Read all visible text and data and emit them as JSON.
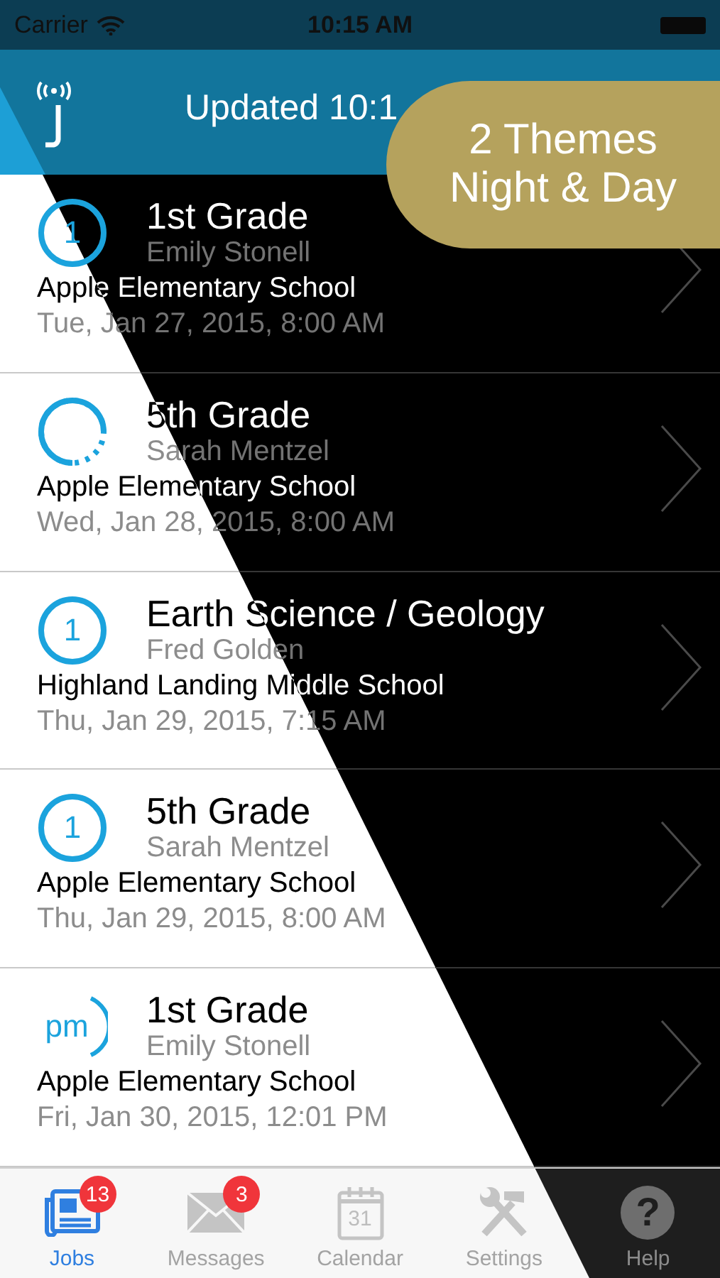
{
  "status_bar": {
    "carrier": "Carrier",
    "time": "10:15 AM"
  },
  "nav_bar": {
    "title": "Updated 10:1"
  },
  "promo_badge": {
    "lines": [
      "2 Themes",
      "Night & Day"
    ]
  },
  "jobs": [
    {
      "icon": {
        "kind": "number",
        "text": "1"
      },
      "title": "1st Grade",
      "teacher": "Emily Stonell",
      "school": "Apple Elementary School",
      "date": "Tue, Jan 27, 2015, 8:00 AM"
    },
    {
      "icon": {
        "kind": "partial"
      },
      "title": "5th Grade",
      "teacher": "Sarah Mentzel",
      "school": "Apple Elementary School",
      "date": "Wed, Jan 28, 2015, 8:00 AM"
    },
    {
      "icon": {
        "kind": "number",
        "text": "1"
      },
      "title": "Earth Science / Geology",
      "teacher": "Fred Golden",
      "school": "Highland Landing Middle School",
      "date": "Thu, Jan 29, 2015, 7:15 AM"
    },
    {
      "icon": {
        "kind": "number",
        "text": "1"
      },
      "title": "5th Grade",
      "teacher": "Sarah Mentzel",
      "school": "Apple Elementary School",
      "date": "Thu, Jan 29, 2015, 8:00 AM"
    },
    {
      "icon": {
        "kind": "pm",
        "text": "pm"
      },
      "title": "1st Grade",
      "teacher": "Emily Stonell",
      "school": "Apple Elementary School",
      "date": "Fri, Jan 30, 2015, 12:01 PM"
    }
  ],
  "tabs": [
    {
      "kind": "jobs",
      "label": "Jobs",
      "selected": true,
      "badge": "13"
    },
    {
      "kind": "messages",
      "label": "Messages",
      "selected": false,
      "badge": "3"
    },
    {
      "kind": "calendar",
      "label": "Calendar",
      "selected": false,
      "day": "31"
    },
    {
      "kind": "settings",
      "label": "Settings",
      "selected": false
    },
    {
      "kind": "help",
      "label": "Help",
      "selected": false,
      "glyph": "?"
    }
  ]
}
